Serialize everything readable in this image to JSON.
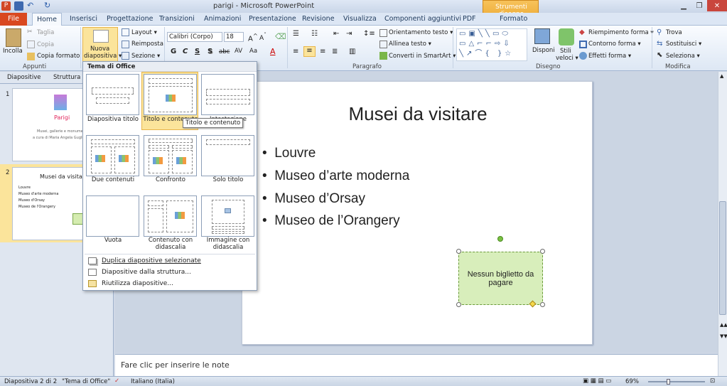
{
  "window": {
    "title": "parigi - Microsoft PowerPoint",
    "context_tab": "Strumenti disegno",
    "app_icon": "powerpoint-icon"
  },
  "tabs": [
    "File",
    "Home",
    "Inserisci",
    "Progettazione",
    "Transizioni",
    "Animazioni",
    "Presentazione",
    "Revisione",
    "Visualizza",
    "Componenti aggiuntivi",
    "PDF",
    "Formato"
  ],
  "ribbon": {
    "appunti": {
      "paste": "Incolla",
      "cut": "Taglia",
      "copy": "Copia",
      "format_painter": "Copia formato",
      "label": "Appunti"
    },
    "diapositive": {
      "new_slide_1": "Nuova",
      "new_slide_2": "diapositiva ▾",
      "layout": "Layout ▾",
      "reset": "Reimposta",
      "section": "Sezione ▾"
    },
    "carattere": {
      "font": "Calibri (Corpo)",
      "size": "18",
      "bold": "G",
      "italic": "C",
      "underline": "S",
      "shadow": "S",
      "strike": "abc"
    },
    "paragrafo": {
      "direction": "Orientamento testo ▾",
      "align": "Allinea testo ▾",
      "smartart": "Converti in SmartArt ▾",
      "label": "Paragrafo"
    },
    "disegno": {
      "arrange_1": "Disponi",
      "quick_styles_1": "Stili",
      "quick_styles_2": "veloci ▾",
      "fill": "Riempimento forma ▾",
      "outline": "Contorno forma ▾",
      "effects": "Effetti forma ▾",
      "label": "Disegno"
    },
    "modifica": {
      "find": "Trova",
      "replace": "Sostituisci ▾",
      "select": "Seleziona ▾",
      "label": "Modifica"
    }
  },
  "left_pane": {
    "tabs": [
      "Diapositive",
      "Struttura"
    ],
    "slide1": {
      "num": "1",
      "title": "Parigi",
      "sub1": "Musei, gallerie e monumen",
      "sub2": "a cura di Maria Angela Gugli"
    },
    "slide2": {
      "num": "2",
      "title": "Musei da visitare",
      "bullets": [
        "Louvre",
        "Museo d'arte moderna",
        "Museo d'Orsay",
        "Museo de l'Orangery"
      ]
    }
  },
  "gallery": {
    "header": "Tema di Office",
    "layouts": [
      {
        "label": "Diapositiva titolo"
      },
      {
        "label": "Titolo e contenuto"
      },
      {
        "label": "Intestazione"
      },
      {
        "label": "Due contenuti"
      },
      {
        "label": "Confronto"
      },
      {
        "label": "Solo titolo"
      },
      {
        "label": "Vuota"
      },
      {
        "label": "Contenuto con didascalia"
      },
      {
        "label": "Immagine con didascalia"
      }
    ],
    "menu": [
      "Duplica diapositive selezionate",
      "Diapositive dalla struttura...",
      "Riutilizza diapositive..."
    ],
    "tooltip": "Titolo e contenuto"
  },
  "slide": {
    "title": "Musei da visitare",
    "bullets": [
      "Louvre",
      "Museo d’arte moderna",
      "Museo d’Orsay",
      "Museo de l’Orangery"
    ],
    "shape_text": "Nessun biglietto da pagare"
  },
  "notes": {
    "placeholder": "Fare clic per inserire le note"
  },
  "status": {
    "slide": "Diapositiva 2 di 2",
    "theme": "\"Tema di Office\"",
    "language": "Italiano (Italia)",
    "zoom": "69%"
  }
}
